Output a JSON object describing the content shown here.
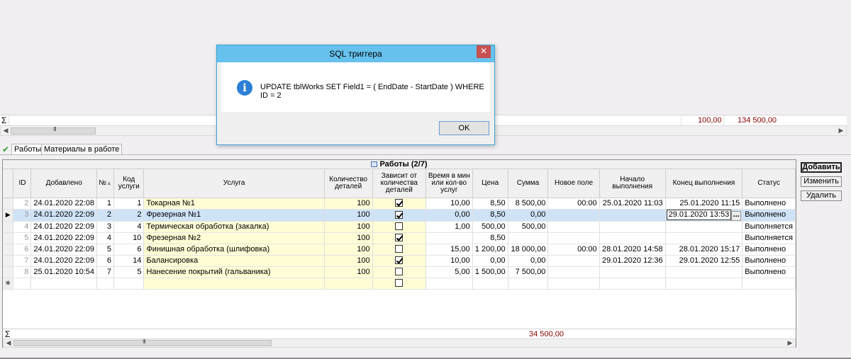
{
  "top_grid": {
    "sigma": "Σ",
    "sum_1": "100,00",
    "sum_2": "134 500,00",
    "scroll_thumb": "III"
  },
  "tabs": [
    {
      "label": "Работы",
      "icon": "check-icon",
      "active": true
    },
    {
      "label": "Материалы в работе",
      "active": false
    }
  ],
  "grid": {
    "caption": "Работы (2/7)",
    "columns": [
      "ID",
      "Добавлено",
      "№",
      "Код услуги",
      "Услуга",
      "Количество деталей",
      "Зависит от количества деталей",
      "Время в мин или кол-во услуг",
      "Цена",
      "Сумма",
      "Новое поле",
      "Начало выполнения",
      "Конец выполнения",
      "Статус"
    ],
    "sort_indicator": "▲",
    "rows": [
      {
        "id": "2",
        "added": "24.01.2020 22:08",
        "num": "1",
        "code": "1",
        "service": "Токарная №1",
        "qty": "100",
        "depends": true,
        "time": "10,00",
        "price": "8,50",
        "sum": "8 500,00",
        "newfield": "00:00",
        "start": "25.01.2020 11:03",
        "end": "25.01.2020 11:15",
        "status": "Выполнено",
        "selected": false
      },
      {
        "id": "3",
        "added": "24.01.2020 22:09",
        "num": "2",
        "code": "2",
        "service": "Фрезерная №1",
        "qty": "100",
        "depends": true,
        "time": "0,00",
        "price": "8,50",
        "sum": "0,00",
        "newfield": "",
        "start": "",
        "end": "29.01.2020 13:53",
        "status": "Выполнено",
        "selected": true
      },
      {
        "id": "4",
        "added": "24.01.2020 22:09",
        "num": "3",
        "code": "4",
        "service": "Термическая обработка (закалка)",
        "qty": "100",
        "depends": false,
        "time": "1,00",
        "price": "500,00",
        "sum": "500,00",
        "newfield": "",
        "start": "",
        "end": "",
        "status": "Выполняется",
        "selected": false
      },
      {
        "id": "5",
        "added": "24.01.2020 22:09",
        "num": "4",
        "code": "10",
        "service": "Фрезерная №2",
        "qty": "100",
        "depends": true,
        "time": "",
        "price": "8,50",
        "sum": "",
        "newfield": "",
        "start": "",
        "end": "",
        "status": "Выполняется",
        "selected": false
      },
      {
        "id": "6",
        "added": "24.01.2020 22:09",
        "num": "5",
        "code": "6",
        "service": "Финишная обработка (шлифовка)",
        "qty": "100",
        "depends": false,
        "time": "15,00",
        "price": "1 200,00",
        "sum": "18 000,00",
        "newfield": "00:00",
        "start": "28.01.2020 14:58",
        "end": "28.01.2020 15:17",
        "status": "Выполнено",
        "selected": false
      },
      {
        "id": "7",
        "added": "24.01.2020 22:09",
        "num": "6",
        "code": "14",
        "service": "Балансировка",
        "qty": "100",
        "depends": true,
        "time": "10,00",
        "price": "0,00",
        "sum": "0,00",
        "newfield": "",
        "start": "29.01.2020 12:36",
        "end": "29.01.2020 12:55",
        "status": "Выполнено",
        "selected": false
      },
      {
        "id": "8",
        "added": "25.01.2020 10:54",
        "num": "7",
        "code": "5",
        "service": "Нанесение покрытий (гальваника)",
        "qty": "100",
        "depends": false,
        "time": "5,00",
        "price": "1 500,00",
        "sum": "7 500,00",
        "newfield": "",
        "start": "",
        "end": "",
        "status": "Выполнено",
        "selected": false
      }
    ],
    "row_pointer": "▶",
    "new_row_marker": "✳",
    "ellipsis": "...",
    "sigma": "Σ",
    "sum_total": "34 500,00",
    "scroll_thumb": "III"
  },
  "buttons": {
    "add": "Добавить",
    "edit": "Изменить",
    "delete": "Удалить"
  },
  "dialog": {
    "title": "SQL триггера",
    "close": "✕",
    "icon": "info-icon",
    "icon_glyph": "i",
    "message": "UPDATE tblWorks SET Field1 = ( EndDate - StartDate ) WHERE ID = 2",
    "ok": "OK"
  },
  "colors": {
    "title_bar": "#66c1ec",
    "selected_row": "#cfe3f7",
    "editable_cell": "#fefdd5",
    "sum_text": "#8b0000"
  }
}
